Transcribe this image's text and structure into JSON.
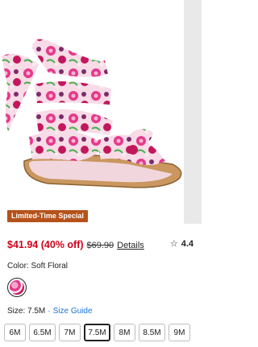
{
  "product": {
    "badge": "Limited-Time Special",
    "sale_price": "$41.94 (40% off)",
    "original_price": "$69.90",
    "details_link": "Details",
    "rating": "4.4",
    "color_label": "Color: Soft Floral",
    "size_label": "Size: 7.5M",
    "size_separator": "·",
    "size_guide": "Size Guide",
    "sizes": [
      "6M",
      "6.5M",
      "7M",
      "7.5M",
      "8M",
      "8.5M",
      "9M"
    ],
    "selected_size": "7.5M"
  },
  "colors": {
    "sale": "#d0021b",
    "badge_bg": "#b5521b",
    "link": "#1a73d9"
  },
  "icons": {
    "rating": "star-outline-icon"
  }
}
